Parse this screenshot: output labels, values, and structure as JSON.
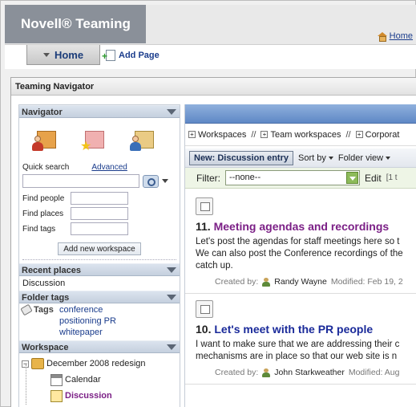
{
  "brand": {
    "logo_text": "Novell® Teaming"
  },
  "header": {
    "home_link": "Home"
  },
  "nav": {
    "home_tab": "Home",
    "add_page": "Add Page"
  },
  "navigator_panel": {
    "title": "Teaming Navigator"
  },
  "left": {
    "navigator_title": "Navigator",
    "quick_search_label": "Quick search",
    "advanced_link": "Advanced",
    "find_people": "Find people",
    "find_places": "Find places",
    "find_tags": "Find tags",
    "add_workspace": "Add new workspace",
    "recent_places_title": "Recent places",
    "recent_item": "Discussion",
    "folder_tags_title": "Folder tags",
    "tags_label": "Tags",
    "tags": [
      "conference",
      "positioning PR",
      "whitepaper"
    ],
    "workspace_title": "Workspace",
    "tree": {
      "root": "December 2008 redesign",
      "child1": "Calendar",
      "child2": "Discussion"
    }
  },
  "right": {
    "crumbs": [
      "Workspaces",
      "Team workspaces",
      "Corporat"
    ],
    "crumb_sep": "//",
    "new_button": "New: Discussion entry",
    "sort_by": "Sort by",
    "folder_view": "Folder view",
    "filter_label": "Filter:",
    "filter_value": "--none--",
    "edit_label": "Edit",
    "page_info": "[1 t",
    "entries": [
      {
        "num": "11.",
        "title": "Meeting agendas and recordings",
        "body1": "Let's post the agendas for staff meetings here so t",
        "body2": "We can also post the Conference recordings of the",
        "body3": "catch up.",
        "created_by_label": "Created by:",
        "author": "Randy Wayne",
        "modified": "Modified: Feb 19, 2"
      },
      {
        "num": "10.",
        "title": "Let's meet with the PR people",
        "body1": "I want to make sure that we are addressing their c",
        "body2": "mechanisms are in place so that our web site is n",
        "created_by_label": "Created by:",
        "author": "John Starkweather",
        "modified": "Modified: Aug"
      }
    ]
  },
  "colors": {
    "entry1_title": "#7b1f86",
    "entry2_title": "#1a2a9a",
    "section_header": "#c5d0de"
  }
}
